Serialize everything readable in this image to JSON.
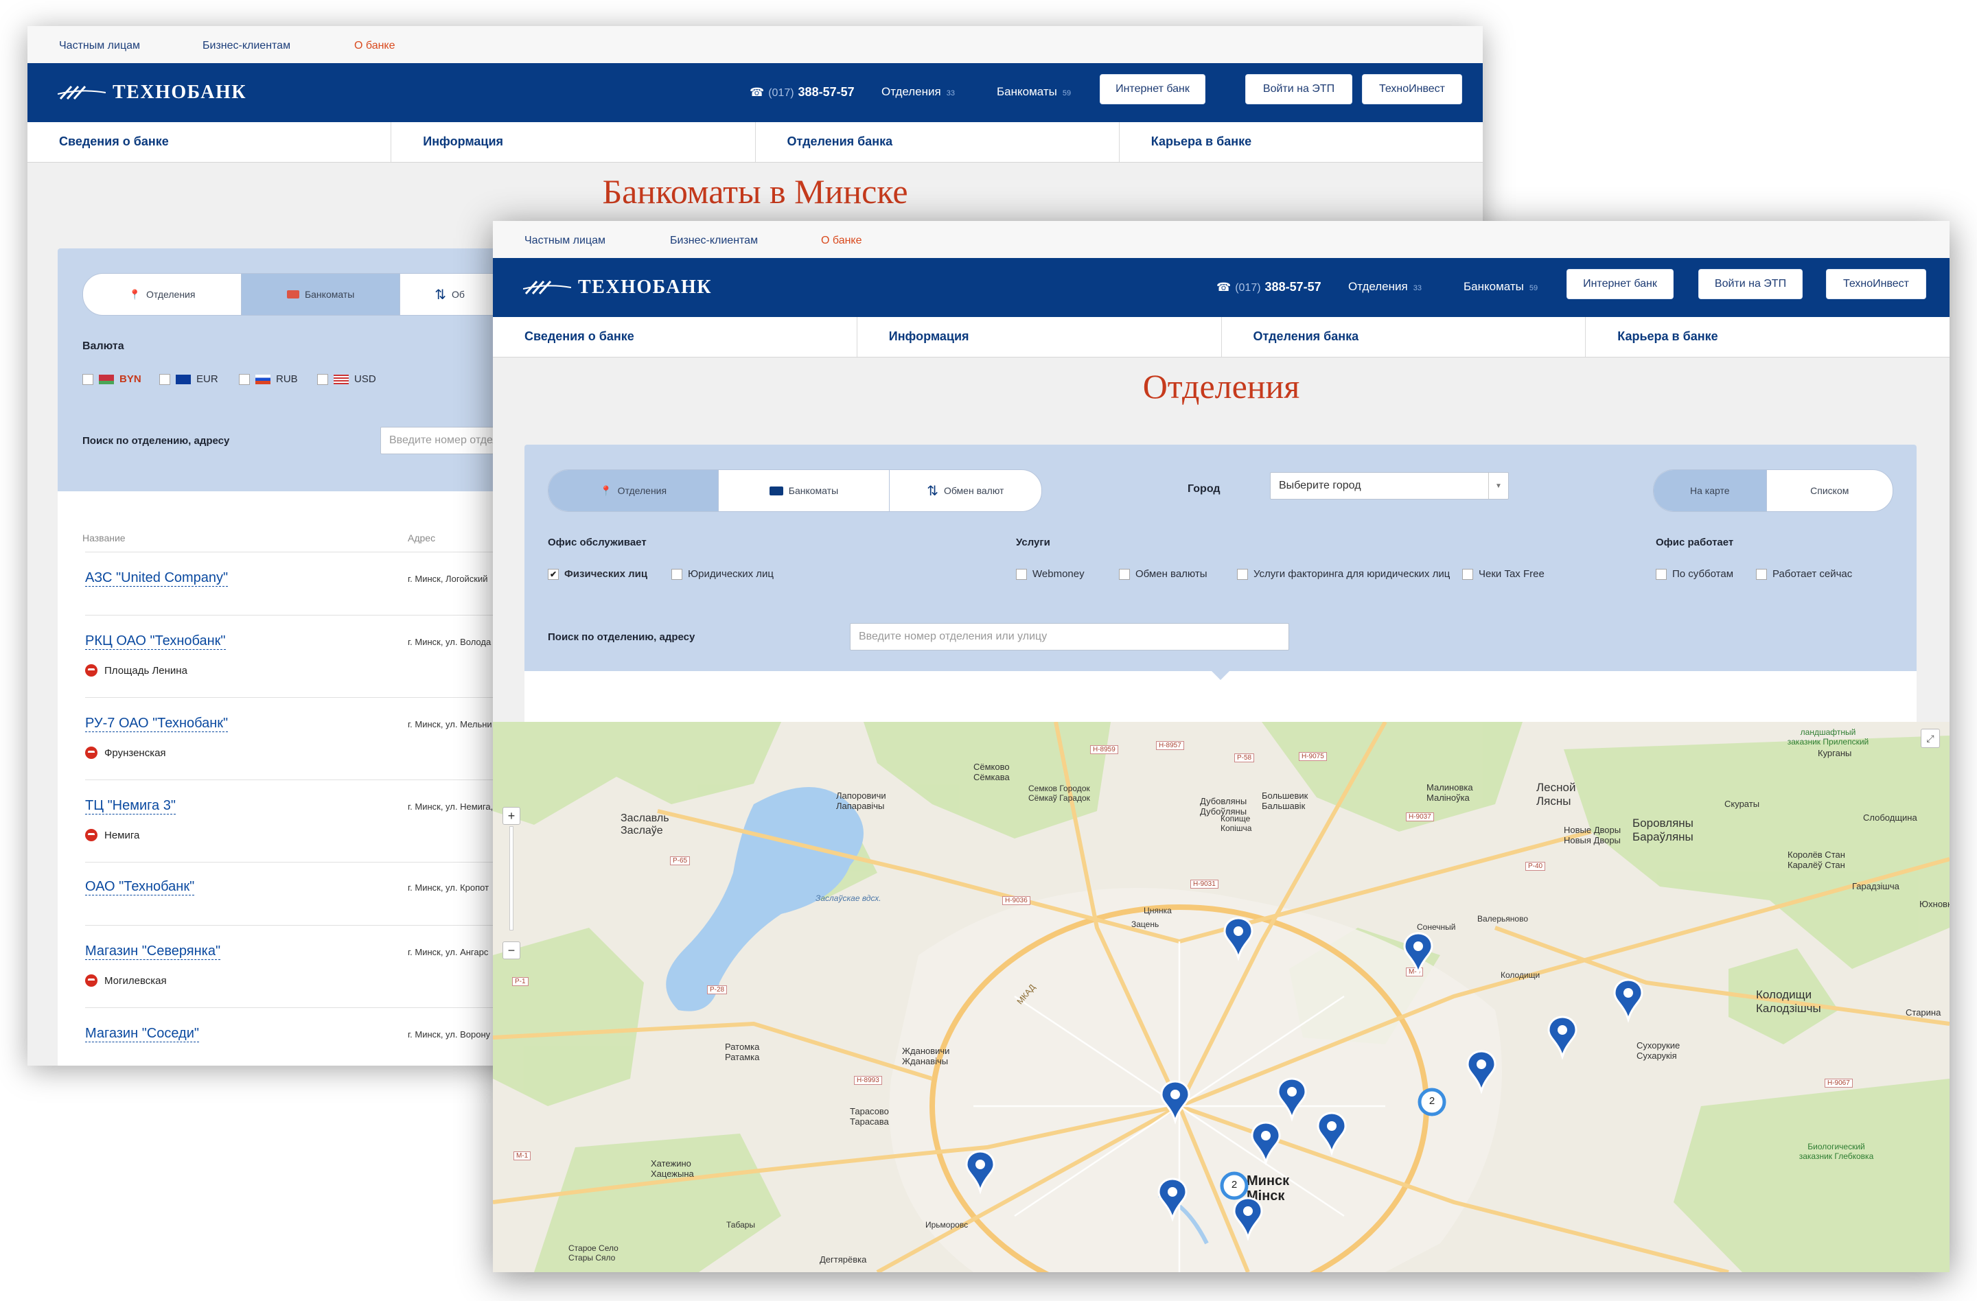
{
  "back": {
    "topbar": [
      "Частным лицам",
      "Бизнес-клиентам",
      "О банке"
    ],
    "logo": "ТЕХНОБАНК",
    "phone": {
      "code": "(017)",
      "number": "388-57-57"
    },
    "branches": {
      "label": "Отделения",
      "count": "33"
    },
    "atms": {
      "label": "Банкоматы",
      "count": "59"
    },
    "buttons": [
      "Интернет банк",
      "Войти на ЭТП",
      "ТехноИнвест"
    ],
    "nav": [
      "Сведения о банке",
      "Информация",
      "Отделения банка",
      "Карьера в банке"
    ],
    "title": "Банкоматы в Минске",
    "tabs": [
      "Отделения",
      "Банкоматы",
      "Об"
    ],
    "currency_label": "Валюта",
    "currencies": [
      "BYN",
      "EUR",
      "RUB",
      "USD"
    ],
    "search_label": "Поиск по отделению, адресу",
    "search_placeholder": "Введите номер отделен",
    "col_name": "Название",
    "col_addr": "Адрес",
    "rows": [
      {
        "name": "АЗС \"United Company\"",
        "addr": "г. Минск, Логойский",
        "metro": ""
      },
      {
        "name": "РКЦ ОАО \"Технобанк\"",
        "addr": "г. Минск, ул. Волода",
        "metro": "Площадь Ленина"
      },
      {
        "name": "РУ-7 ОАО \"Технобанк\"",
        "addr": "г. Минск, ул. Мельни",
        "metro": "Фрунзенская"
      },
      {
        "name": "ТЦ \"Немига 3\"",
        "addr": "г. Минск, ул. Немига,",
        "metro": "Немига"
      },
      {
        "name": "ОАО \"Технобанк\"",
        "addr": "г. Минск, ул. Кропот",
        "metro": ""
      },
      {
        "name": "Магазин \"Северянка\"",
        "addr": "г. Минск, ул. Ангарс",
        "metro": "Могилевская"
      },
      {
        "name": "Магазин \"Соседи\"",
        "addr": "г. Минск, ул. Ворону",
        "metro": ""
      }
    ]
  },
  "front": {
    "topbar": [
      "Частным лицам",
      "Бизнес-клиентам",
      "О банке"
    ],
    "logo": "ТЕХНОБАНК",
    "phone": {
      "code": "(017)",
      "number": "388-57-57"
    },
    "branches": {
      "label": "Отделения",
      "count": "33"
    },
    "atms": {
      "label": "Банкоматы",
      "count": "59"
    },
    "buttons": [
      "Интернет банк",
      "Войти на ЭТП",
      "ТехноИнвест"
    ],
    "nav": [
      "Сведения о банке",
      "Информация",
      "Отделения банка",
      "Карьера в банке"
    ],
    "title": "Отделения",
    "tabs": [
      "Отделения",
      "Банкоматы",
      "Обмен валют"
    ],
    "city_label": "Город",
    "city_select": "Выберите город",
    "view_toggle": [
      "На карте",
      "Списком"
    ],
    "serves_label": "Офис обслуживает",
    "serves": [
      {
        "label": "Физических лиц",
        "checked": true
      },
      {
        "label": "Юридических лиц",
        "checked": false
      }
    ],
    "services_label": "Услуги",
    "services": [
      "Webmoney",
      "Обмен валюты",
      "Услуги факторинга для юридических лиц",
      "Чеки Tax Free"
    ],
    "works_label": "Офис работает",
    "works": [
      "По субботам",
      "Работает сейчас"
    ],
    "search_label": "Поиск по отделению, адресу",
    "search_placeholder": "Введите номер отделения или улицу",
    "map_labels": [
      "Заслаўе",
      "Заславль",
      "Лапоровичи",
      "Лапаравічы",
      "Сёмково",
      "Сёмкава",
      "Семков Городок",
      "Сёмкаў Гарадок",
      "Дубовляны",
      "Дубоўляны",
      "Большевик",
      "Бальшавік",
      "Малиновка",
      "Маліноўка",
      "Лесной",
      "Лясны",
      "Боровляны",
      "Бараўляны",
      "Новые Дворы",
      "Новыя Дворы",
      "Ратомка",
      "Ратамка",
      "Ждановичи",
      "Жданавічы",
      "Тарасово",
      "Тарасава",
      "Хатежино",
      "Хацежына",
      "Колодищи",
      "Калодзішчы",
      "Сухорукие",
      "Сухарукія",
      "Минск",
      "Мінск",
      "Цнянка",
      "Зацень",
      "Сонечный",
      "Колодищи",
      "Валерьяново",
      "Заслаўскае вдсх.",
      "Старое Село",
      "Стары Сяло",
      "Дегтярёвка",
      "Ирьморовс",
      "Табары",
      "Копище",
      "Копішча",
      "Курганы",
      "Скураты",
      "Слободщина",
      "Королёв Стан",
      "Каралёў Стан",
      "Гарадзішча",
      "Юхновка",
      "Старина",
      "Биологический заказник Глебковка",
      "ландшафтный заказник Прилепский"
    ],
    "map_routes": [
      "Н-8959",
      "Н-8957",
      "Р-58",
      "Н-9075",
      "Н-9037",
      "Н-9036",
      "Н-9031",
      "Р-40",
      "Р-65",
      "Р-28",
      "Н-8993",
      "Н-9067",
      "М-1",
      "М-9",
      "Р-1",
      "МКАД"
    ],
    "clusters": [
      "2",
      "2"
    ]
  }
}
